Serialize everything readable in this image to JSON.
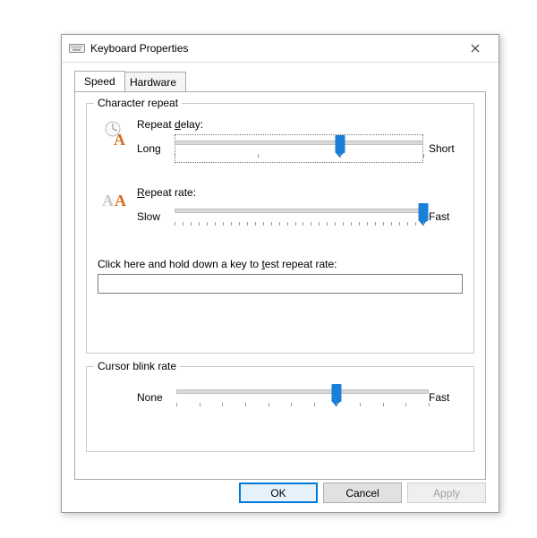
{
  "window": {
    "title": "Keyboard Properties"
  },
  "tabs": {
    "speed": "Speed",
    "hardware": "Hardware",
    "active": "speed"
  },
  "groups": {
    "char_repeat": {
      "legend": "Character repeat",
      "repeat_delay": {
        "label_pre": "Repeat ",
        "label_ul": "d",
        "label_post": "elay:",
        "left": "Long",
        "right": "Short",
        "min": 0,
        "max": 3,
        "value": 2
      },
      "repeat_rate": {
        "label_ul": "R",
        "label_post": "epeat rate:",
        "left": "Slow",
        "right": "Fast",
        "min": 0,
        "max": 31,
        "value": 31
      },
      "test_label_pre": "Click here and hold down a key to ",
      "test_label_ul": "t",
      "test_label_post": "est repeat rate:",
      "test_value": ""
    },
    "cursor_blink": {
      "legend_pre": "Cursor ",
      "legend_ul": "b",
      "legend_post": "link rate",
      "left": "None",
      "right": "Fast",
      "min": 0,
      "max": 11,
      "value": 7
    }
  },
  "buttons": {
    "ok": "OK",
    "cancel": "Cancel",
    "apply": "Apply"
  },
  "icons": {
    "keyboard": "keyboard-icon",
    "close": "close-icon",
    "clockA": "repeat-delay-icon",
    "AA": "repeat-rate-icon"
  }
}
